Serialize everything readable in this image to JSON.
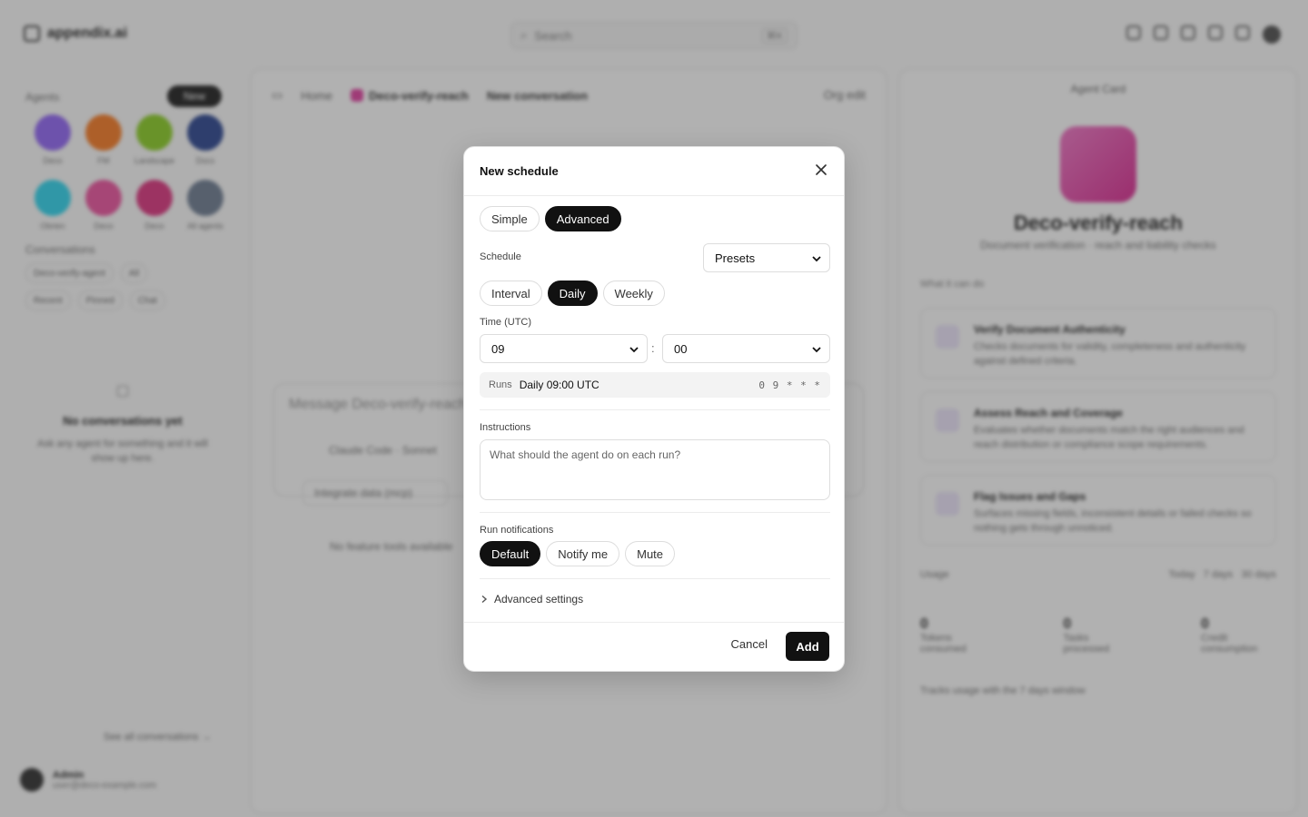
{
  "background": {
    "brand": "appendix.ai",
    "search_placeholder": "Search",
    "search_shortcut": "⌘K",
    "agents_label": "Agents",
    "new_button": "New",
    "agents": [
      {
        "name": "Deco",
        "color": "#8b5cf6"
      },
      {
        "name": "FM",
        "color": "#f97316"
      },
      {
        "name": "Landscape",
        "color": "#84cc16"
      },
      {
        "name": "Docs",
        "color": "#1e3a8a"
      },
      {
        "name": "Obrien",
        "color": "#22d3ee"
      },
      {
        "name": "Deco",
        "color": "#ec4899"
      },
      {
        "name": "Deco",
        "color": "#db2777"
      },
      {
        "name": "All agents",
        "color": "#64748b"
      }
    ],
    "conversations_label": "Conversations",
    "chips": [
      "Deco-verify-agent",
      "All",
      "Recent",
      "Pinned",
      "Chat"
    ],
    "empty_title": "No conversations yet",
    "empty_sub": "Ask any agent for something and it will show up here.",
    "see_all": "See all conversations →",
    "user_name": "Admin",
    "user_email": "user@deco-example.com",
    "crumb_home": "Home",
    "crumb_agent": "Deco-verify-reach",
    "crumb_conv": "New conversation",
    "org_edit": "Org edit",
    "message_placeholder": "Message Deco-verify-reach",
    "model": "Claude Code · Sonnet",
    "mcp_label": "Integrate data (mcp)",
    "no_features": "No feature tools available",
    "panel_title": "Agent Card",
    "agent_name": "Deco-verify-reach",
    "agent_desc": "Document verification · reach and liability checks",
    "what_it_can_do": "What it can do",
    "capabilities": [
      {
        "title": "Verify Document Authenticity",
        "desc": "Checks documents for validity, completeness and authenticity against defined criteria."
      },
      {
        "title": "Assess Reach and Coverage",
        "desc": "Evaluates whether documents match the right audiences and reach distribution or compliance scope requirements."
      },
      {
        "title": "Flag Issues and Gaps",
        "desc": "Surfaces missing fields, inconsistent details or failed checks so nothing gets through unnoticed."
      }
    ],
    "usage_label": "Usage",
    "ranges": [
      "Today",
      "7 days",
      "30 days"
    ],
    "stat_values": [
      "0",
      "0",
      "0"
    ],
    "stat_labels": [
      "Tokens consumed",
      "Tasks processed",
      "Credit consumption"
    ],
    "stats_note": "Tracks usage with the 7 days window"
  },
  "modal": {
    "title": "New schedule",
    "mode_tabs": [
      {
        "label": "Simple",
        "active": false
      },
      {
        "label": "Advanced",
        "active": true
      }
    ],
    "schedule_label": "Schedule",
    "presets_value": "Presets",
    "frequency_tabs": [
      {
        "label": "Interval",
        "active": false
      },
      {
        "label": "Daily",
        "active": true
      },
      {
        "label": "Weekly",
        "active": false
      }
    ],
    "time_label": "Time (UTC)",
    "hour_value": "09",
    "separator": ":",
    "minute_value": "00",
    "runs_label": "Runs",
    "runs_value": "Daily 09:00 UTC",
    "cron": "0 9 * * *",
    "instructions_label": "Instructions",
    "instructions_placeholder": "What should the agent do on each run?",
    "notifications_label": "Run notifications",
    "notification_tabs": [
      {
        "label": "Default",
        "active": true
      },
      {
        "label": "Notify me",
        "active": false
      },
      {
        "label": "Mute",
        "active": false
      }
    ],
    "advanced_settings": "Advanced settings",
    "cancel_label": "Cancel",
    "add_label": "Add"
  }
}
